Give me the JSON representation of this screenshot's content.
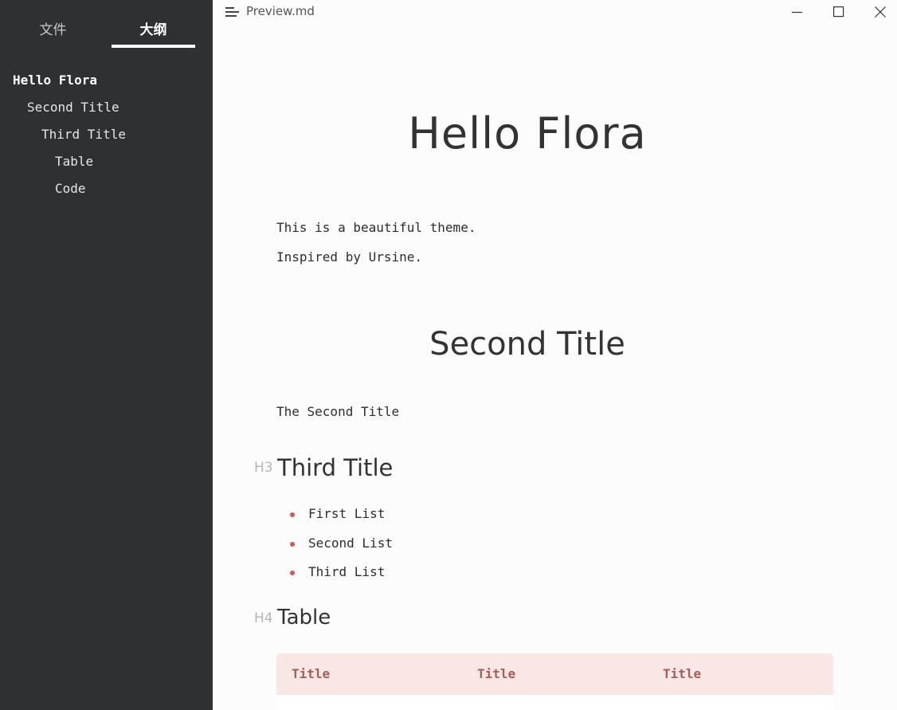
{
  "window": {
    "doc_title": "Preview.md"
  },
  "sidebar": {
    "tabs": [
      {
        "label": "文件",
        "active": false
      },
      {
        "label": "大纲",
        "active": true
      }
    ],
    "outline": [
      {
        "label": "Hello Flora",
        "level": 1
      },
      {
        "label": "Second Title",
        "level": 2
      },
      {
        "label": "Third Title",
        "level": 3
      },
      {
        "label": "Table",
        "level": 4
      },
      {
        "label": "Code",
        "level": 4
      }
    ]
  },
  "document": {
    "h1": "Hello Flora",
    "paragraphs": [
      "This is a beautiful theme.",
      "Inspired by Ursine."
    ],
    "h2": "Second Title",
    "h2_paragraph": "The Second Title",
    "h3": {
      "marker": "H3",
      "text": "Third Title"
    },
    "list": [
      "First List",
      "Second List",
      "Third List"
    ],
    "h4": {
      "marker": "H4",
      "text": "Table"
    },
    "table": {
      "headers": [
        "Title",
        "Title",
        "Title"
      ]
    }
  },
  "colors": {
    "sidebar_bg": "#2e3033",
    "content_bg": "#fcfcfc",
    "accent": "#d0585a",
    "table_header_bg": "#f9e7e6",
    "table_header_text": "#a65c58"
  }
}
